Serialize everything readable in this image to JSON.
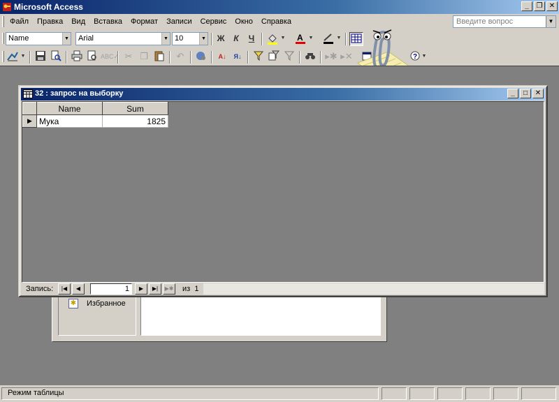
{
  "window": {
    "title": "Microsoft Access"
  },
  "menu": [
    "Файл",
    "Правка",
    "Вид",
    "Вставка",
    "Формат",
    "Записи",
    "Сервис",
    "Окно",
    "Справка"
  ],
  "question_box": {
    "placeholder": "Введите вопрос"
  },
  "format_toolbar": {
    "object_combo": "Name",
    "font_combo": "Arial",
    "size_combo": "10",
    "bold_label": "Ж",
    "italic_label": "К",
    "underline_label": "Ч"
  },
  "database_window": {
    "favorites_label": "Избранное"
  },
  "query_window": {
    "title": "32 : запрос на выборку",
    "columns": [
      "Name",
      "Sum"
    ],
    "rows": [
      {
        "name": "Мука",
        "sum": "1825"
      }
    ],
    "nav": {
      "label": "Запись:",
      "current": "1",
      "of_label": "из",
      "total": "1"
    }
  },
  "statusbar": {
    "text": "Режим таблицы"
  },
  "colors": {
    "titlebar": "#0a246a",
    "mdi_background": "#808080",
    "chrome": "#d4d0c8"
  }
}
